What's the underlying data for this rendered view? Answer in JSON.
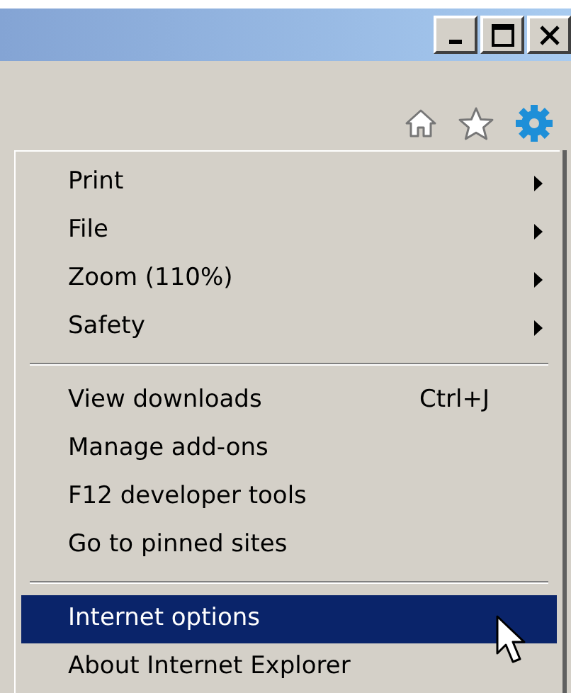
{
  "window": {
    "buttons": [
      {
        "kind": "minimize"
      },
      {
        "kind": "maximize"
      },
      {
        "kind": "close"
      }
    ]
  },
  "toolbar": {
    "icons": [
      {
        "kind": "home"
      },
      {
        "kind": "favorites"
      },
      {
        "kind": "tools"
      }
    ]
  },
  "menu": {
    "items": [
      {
        "kind": "submenu",
        "label": "Print",
        "selected": false
      },
      {
        "kind": "submenu",
        "label": "File",
        "selected": false
      },
      {
        "kind": "submenu",
        "label": "Zoom (110%)",
        "selected": false
      },
      {
        "kind": "submenu",
        "label": "Safety",
        "selected": false
      },
      {
        "kind": "separator"
      },
      {
        "kind": "command",
        "label": "View downloads",
        "shortcut": "Ctrl+J",
        "selected": false
      },
      {
        "kind": "command",
        "label": "Manage add-ons",
        "selected": false
      },
      {
        "kind": "command",
        "label": "F12 developer tools",
        "selected": false
      },
      {
        "kind": "command",
        "label": "Go to pinned sites",
        "selected": false
      },
      {
        "kind": "separator"
      },
      {
        "kind": "command",
        "label": "Internet options",
        "selected": true
      },
      {
        "kind": "command",
        "label": "About Internet Explorer",
        "selected": false
      }
    ]
  }
}
